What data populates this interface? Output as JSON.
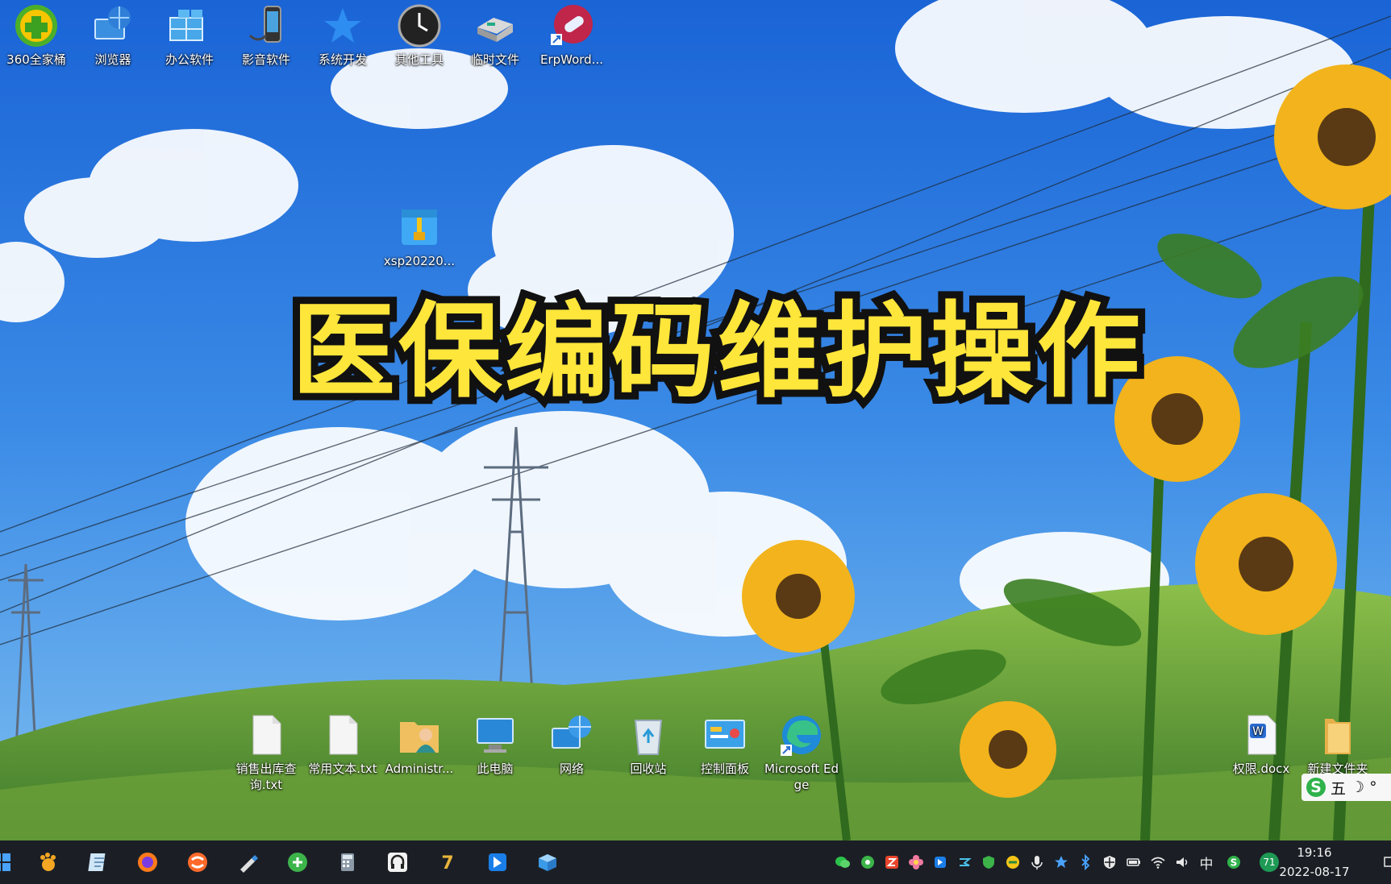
{
  "banner": {
    "title": "医保编码维护操作",
    "color": "#ffe63a"
  },
  "desktop_top": [
    {
      "label": "360全家桶",
      "icon": "360-suite-icon"
    },
    {
      "label": "浏览器",
      "icon": "browser-globe-icon"
    },
    {
      "label": "办公软件",
      "icon": "office-windows-icon"
    },
    {
      "label": "影音软件",
      "icon": "media-phone-icon"
    },
    {
      "label": "系统开发",
      "icon": "star-icon"
    },
    {
      "label": "其他工具",
      "icon": "clock-icon"
    },
    {
      "label": "临时文件",
      "icon": "drive-icon"
    },
    {
      "label": "ErpWord...",
      "icon": "pill-shortcut-icon"
    }
  ],
  "desktop_mid": {
    "label": "xsp20220...",
    "icon": "zip-archive-icon"
  },
  "desktop_bottom": [
    {
      "label": "销售出库查询.txt",
      "icon": "text-file-icon"
    },
    {
      "label": "常用文本.txt",
      "icon": "text-file-icon"
    },
    {
      "label": "Administr...",
      "icon": "user-folder-icon"
    },
    {
      "label": "此电脑",
      "icon": "computer-icon"
    },
    {
      "label": "网络",
      "icon": "network-icon"
    },
    {
      "label": "回收站",
      "icon": "recycle-bin-icon"
    },
    {
      "label": "控制面板",
      "icon": "control-panel-icon"
    },
    {
      "label": "Microsoft Edge",
      "icon": "edge-icon"
    }
  ],
  "desktop_right": [
    {
      "label": "权限.docx",
      "icon": "word-doc-icon"
    },
    {
      "label": "新建文件夹",
      "icon": "folder-icon"
    }
  ],
  "taskbar": {
    "apps": [
      "baidu-paw-icon",
      "notepad-icon",
      "firefox-icon",
      "sogou-browser-icon",
      "tool-pen-icon",
      "360-browser-icon",
      "calculator-icon",
      "headset-icon",
      "7zip-icon",
      "feishu-icon",
      "package-icon"
    ],
    "tray": [
      "wechat-icon",
      "browser-tray-icon",
      "office-tray-icon",
      "flower-icon",
      "app-tray-icon",
      "sogou-tray-icon",
      "shield-icon",
      "green-app-icon",
      "microphone-icon",
      "star-tray-icon",
      "bluetooth-icon",
      "security-icon",
      "battery-icon",
      "wifi-icon",
      "speaker-icon"
    ],
    "input_lang": "中",
    "temp_badge": "71",
    "time": "19:16",
    "date": "2022-08-17"
  },
  "ime_bar": {
    "logo": "S",
    "mode": "五",
    "moon": "☽",
    "dot": "°"
  },
  "colors": {
    "sky_top": "#1a64d6",
    "sky_bottom": "#6bb3ee",
    "taskbar": "#1b1f25"
  }
}
